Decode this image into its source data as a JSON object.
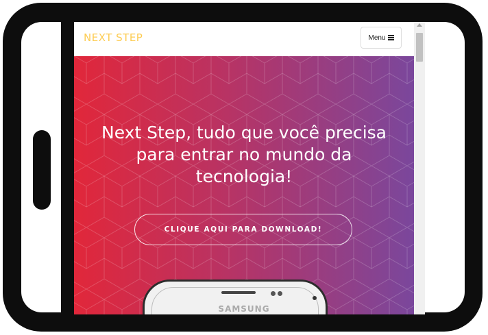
{
  "navbar": {
    "brand": "NEXT STEP",
    "menu_label": "Menu"
  },
  "hero": {
    "headline_line1": "Next Step, tudo que você precisa",
    "headline_line2": "para entrar no mundo da",
    "headline_line3": "tecnologia!",
    "download_button": "CLIQUE AQUI PARA DOWNLOAD!",
    "phone_brand": "SAMSUNG"
  },
  "colors": {
    "brand": "#fdcc52",
    "gradient_start": "#e1273a",
    "gradient_end": "#7a479c"
  },
  "icons": [
    "menu-bars-icon"
  ],
  "scrollbar": {
    "position": 0.0
  }
}
